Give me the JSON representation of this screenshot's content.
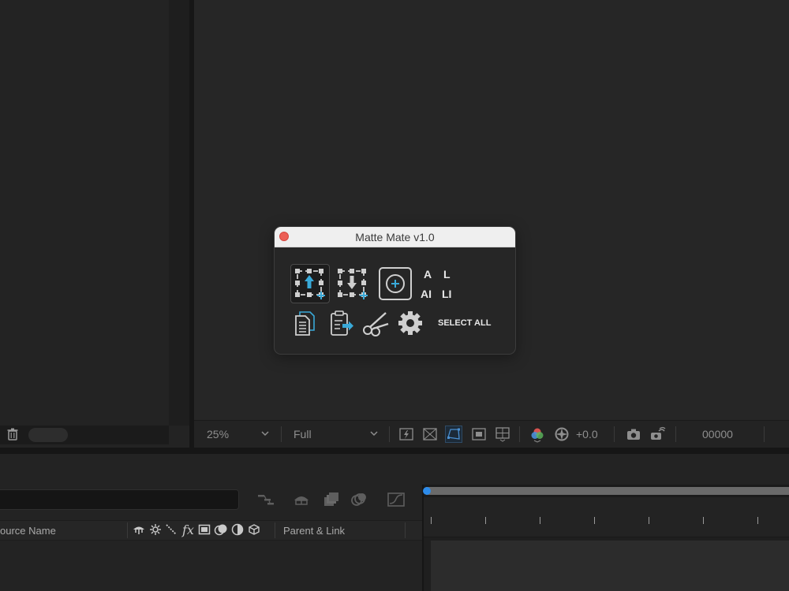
{
  "viewer_toolbar": {
    "zoom": "25%",
    "resolution": "Full",
    "exposure": "+0.0",
    "timecode": "00000"
  },
  "timeline": {
    "col_source_name": "ource Name",
    "col_parent_link": "Parent & Link",
    "fx_label": "fx"
  },
  "dialog": {
    "title": "Matte Mate v1.0",
    "label_a": "A",
    "label_l": "L",
    "label_ai": "AI",
    "label_li": "LI",
    "select_all": "SELECT ALL"
  },
  "colors": {
    "accent_blue": "#39a9d8",
    "close_red": "#ec5f56",
    "playhead_blue": "#2d8ceb"
  },
  "icons": [
    "trash-icon",
    "upload-mask-icon",
    "download-mask-icon",
    "add-circle-icon",
    "copy-icon",
    "paste-icon",
    "scissors-icon",
    "gear-icon",
    "camera-icon",
    "snapshot-icon",
    "color-channel-icon",
    "exposure-icon",
    "grid-icon",
    "mask-view-icon"
  ]
}
